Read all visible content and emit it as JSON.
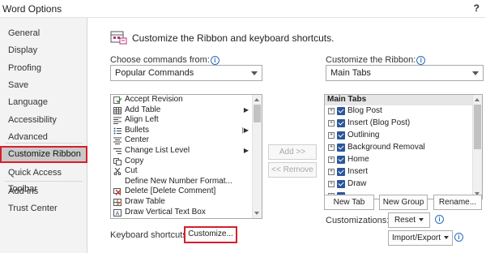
{
  "window": {
    "title": "Word Options",
    "help": "?"
  },
  "sidebar": {
    "items": [
      {
        "label": "General"
      },
      {
        "label": "Display"
      },
      {
        "label": "Proofing"
      },
      {
        "label": "Save"
      },
      {
        "label": "Language"
      },
      {
        "label": "Accessibility"
      },
      {
        "label": "Advanced"
      },
      {
        "label": "Customize Ribbon",
        "selected": true
      },
      {
        "label": "Quick Access Toolbar"
      },
      {
        "label": "Add-ins"
      },
      {
        "label": "Trust Center"
      }
    ]
  },
  "main": {
    "header": "Customize the Ribbon and keyboard shortcuts.",
    "choose_label": "Choose commands from:",
    "choose_value": "Popular Commands",
    "customize_label": "Customize the Ribbon:",
    "customize_value": "Main Tabs",
    "commands": [
      {
        "label": "Accept Revision",
        "icon": "accept-revision-icon"
      },
      {
        "label": "Add Table",
        "icon": "table-icon",
        "submenu": "▶"
      },
      {
        "label": "Align Left",
        "icon": "align-left-icon"
      },
      {
        "label": "Bullets",
        "icon": "bullets-icon",
        "submenu": "|▶"
      },
      {
        "label": "Center",
        "icon": "center-icon"
      },
      {
        "label": "Change List Level",
        "icon": "list-level-icon",
        "submenu": "▶"
      },
      {
        "label": "Copy",
        "icon": "copy-icon"
      },
      {
        "label": "Cut",
        "icon": "cut-icon"
      },
      {
        "label": "Define New Number Format...",
        "icon": "blank-icon"
      },
      {
        "label": "Delete [Delete Comment]",
        "icon": "delete-comment-icon"
      },
      {
        "label": "Draw Table",
        "icon": "draw-table-icon"
      },
      {
        "label": "Draw Vertical Text Box",
        "icon": "text-box-icon"
      }
    ],
    "add_button": "Add >>",
    "remove_button": "<< Remove",
    "tabs_header": "Main Tabs",
    "tabs": [
      {
        "label": "Blog Post"
      },
      {
        "label": "Insert (Blog Post)"
      },
      {
        "label": "Outlining"
      },
      {
        "label": "Background Removal"
      },
      {
        "label": "Home"
      },
      {
        "label": "Insert"
      },
      {
        "label": "Draw"
      }
    ],
    "new_tab": "New Tab",
    "new_group": "New Group",
    "rename": "Rename...",
    "customizations_label": "Customizations:",
    "reset": "Reset",
    "import_export": "Import/Export",
    "keyboard_label": "Keyboard shortcuts:",
    "customize_button": "Customize..."
  },
  "colors": {
    "highlight": "#d6202a",
    "checkbox": "#2b579a"
  }
}
